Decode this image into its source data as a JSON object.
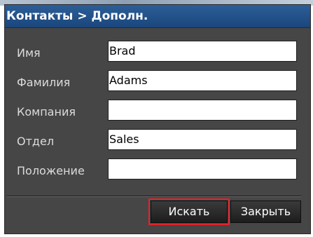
{
  "window": {
    "title": "Контакты > Дополн."
  },
  "form": {
    "fields": [
      {
        "label": "Имя",
        "value": "Brad"
      },
      {
        "label": "Фамилия",
        "value": "Adams"
      },
      {
        "label": "Компания",
        "value": ""
      },
      {
        "label": "Отдел",
        "value": "Sales"
      },
      {
        "label": "Положение",
        "value": ""
      }
    ]
  },
  "buttons": {
    "search_label": "Искать",
    "close_label": "Закрыть"
  },
  "colors": {
    "titlebar": "#1f4c85",
    "panel": "#464646",
    "highlight_outline": "#e0242a"
  }
}
